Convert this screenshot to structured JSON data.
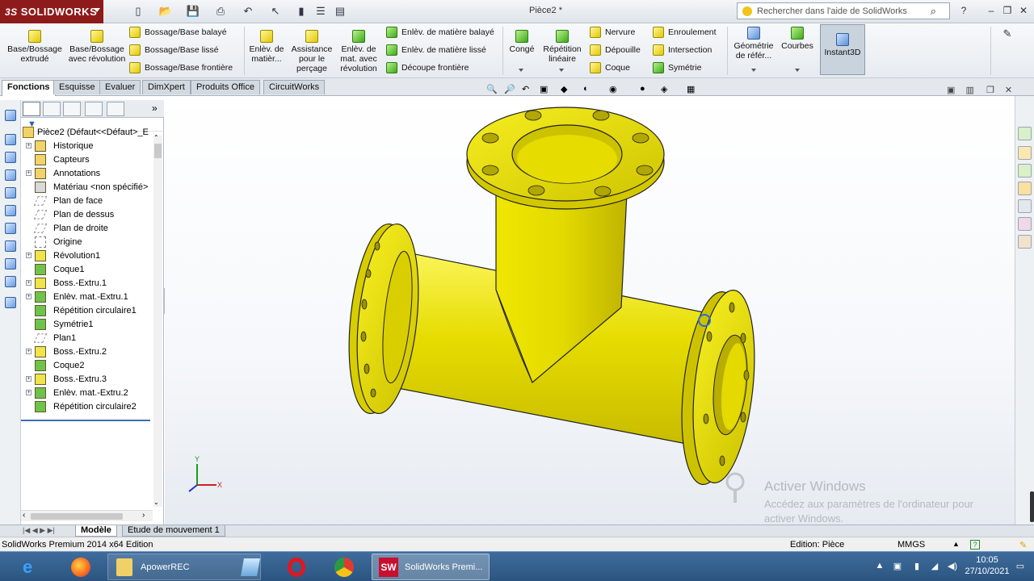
{
  "app": {
    "logo_text": "SOLIDWORKS",
    "logo_prefix": "3S",
    "document_title": "Pièce2 *",
    "help_search_placeholder": "Rechercher dans l'aide de SolidWorks"
  },
  "commands": {
    "base_bossage_extrude": "Base/Bossage extrudé",
    "base_bossage_revolution": "Base/Bossage avec révolution",
    "bossage_balaye": "Bossage/Base balayé",
    "bossage_lisse": "Bossage/Base lissé",
    "bossage_frontiere": "Bossage/Base frontière",
    "enlev_matiere": "Enlèv. de matièr...",
    "assistance_percage": "Assistance pour le perçage",
    "enlev_revolution": "Enlèv. de mat. avec révolution",
    "enlev_balaye": "Enlèv. de matière balayé",
    "enlev_lisse": "Enlèv. de matière lissé",
    "decoupe_frontiere": "Découpe frontière",
    "conge": "Congé",
    "repetition_lineaire": "Répétition linéaire",
    "nervure": "Nervure",
    "depouille": "Dépouille",
    "coque": "Coque",
    "enroulement": "Enroulement",
    "intersection": "Intersection",
    "symetrie": "Symétrie",
    "geometrie_ref": "Géométrie de référ...",
    "courbes": "Courbes",
    "instant3d": "Instant3D"
  },
  "tabs": [
    "Fonctions",
    "Esquisse",
    "Evaluer",
    "DimXpert",
    "Produits Office",
    "CircuitWorks"
  ],
  "tree": {
    "root": "Pièce2  (Défaut<<Défaut>_E",
    "items": [
      {
        "label": "Historique",
        "icon": "history-icon",
        "expandable": true
      },
      {
        "label": "Capteurs",
        "icon": "sensor-icon",
        "expandable": false
      },
      {
        "label": "Annotations",
        "icon": "annotation-icon",
        "expandable": true
      },
      {
        "label": "Matériau <non spécifié>",
        "icon": "material-icon",
        "expandable": false
      },
      {
        "label": "Plan de face",
        "icon": "plane-icon",
        "expandable": false
      },
      {
        "label": "Plan de dessus",
        "icon": "plane-icon",
        "expandable": false
      },
      {
        "label": "Plan de droite",
        "icon": "plane-icon",
        "expandable": false
      },
      {
        "label": "Origine",
        "icon": "origin-icon",
        "expandable": false
      },
      {
        "label": "Révolution1",
        "icon": "revolve-icon",
        "expandable": true
      },
      {
        "label": "Coque1",
        "icon": "shell-icon",
        "expandable": false
      },
      {
        "label": "Boss.-Extru.1",
        "icon": "extrude-icon",
        "expandable": true
      },
      {
        "label": "Enlèv. mat.-Extru.1",
        "icon": "cut-extrude-icon",
        "expandable": true
      },
      {
        "label": "Répétition circulaire1",
        "icon": "circular-pattern-icon",
        "expandable": false
      },
      {
        "label": "Symétrie1",
        "icon": "mirror-icon",
        "expandable": false
      },
      {
        "label": "Plan1",
        "icon": "plane-icon",
        "expandable": false
      },
      {
        "label": "Boss.-Extru.2",
        "icon": "extrude-icon",
        "expandable": true
      },
      {
        "label": "Coque2",
        "icon": "shell-icon",
        "expandable": false
      },
      {
        "label": "Boss.-Extru.3",
        "icon": "extrude-icon",
        "expandable": true
      },
      {
        "label": "Enlèv. mat.-Extru.2",
        "icon": "cut-extrude-icon",
        "expandable": true
      },
      {
        "label": "Répétition circulaire2",
        "icon": "circular-pattern-icon",
        "expandable": false
      }
    ]
  },
  "bottom_tabs": [
    "Modèle",
    "Etude de mouvement 1"
  ],
  "status": {
    "edition": "SolidWorks Premium 2014 x64 Edition",
    "mode": "Edition: Pièce",
    "units": "MMGS"
  },
  "watermark": {
    "title": "Activer Windows",
    "subtitle": "Accédez aux paramètres de l'ordinateur pour activer Windows."
  },
  "taskbar": {
    "apower": "ApowerREC",
    "solidworks": "SolidWorks Premi...",
    "time": "10:05",
    "date": "27/10/2021"
  },
  "triad": {
    "x": "X",
    "y": "Y"
  },
  "colors": {
    "model_yellow": "#e8e000",
    "logo_red": "#8e1b1b",
    "taskbar_blue": "#2b5580"
  }
}
